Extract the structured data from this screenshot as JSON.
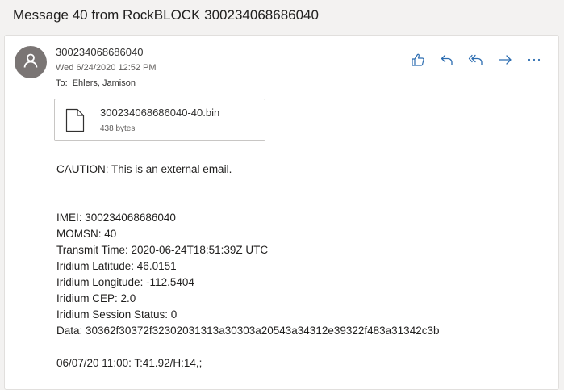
{
  "subject": "Message 40 from RockBLOCK 300234068686040",
  "message": {
    "sender": "300234068686040",
    "date": "Wed 6/24/2020 12:52 PM",
    "to_label": "To:",
    "to_value": "Ehlers, Jamison",
    "avatar_icon": "person-icon"
  },
  "actions": [
    {
      "name": "like-button",
      "icon": "thumbs-up-icon"
    },
    {
      "name": "reply-button",
      "icon": "reply-icon"
    },
    {
      "name": "reply-all-button",
      "icon": "reply-all-icon"
    },
    {
      "name": "forward-button",
      "icon": "forward-arrow-icon"
    },
    {
      "name": "more-actions-button",
      "icon": "more-icon"
    }
  ],
  "attachment": {
    "name": "300234068686040-40.bin",
    "size": "438 bytes",
    "icon": "document-icon"
  },
  "body": {
    "caution": "CAUTION: This is an external email.",
    "lines": [
      "IMEI: 300234068686040",
      "MOMSN: 40",
      "Transmit Time: 2020-06-24T18:51:39Z UTC",
      "Iridium Latitude: 46.0151",
      "Iridium Longitude: -112.5404",
      "Iridium CEP: 2.0",
      "Iridium Session Status: 0",
      "Data: 30362f30372f32302031313a30303a20543a34312e39322f483a31342c3b"
    ],
    "decoded": "06/07/20 11:00: T:41.92/H:14,;"
  },
  "colors": {
    "accent": "#2b6cb0",
    "avatar": "#7a7574",
    "background": "#f3f2f1"
  }
}
